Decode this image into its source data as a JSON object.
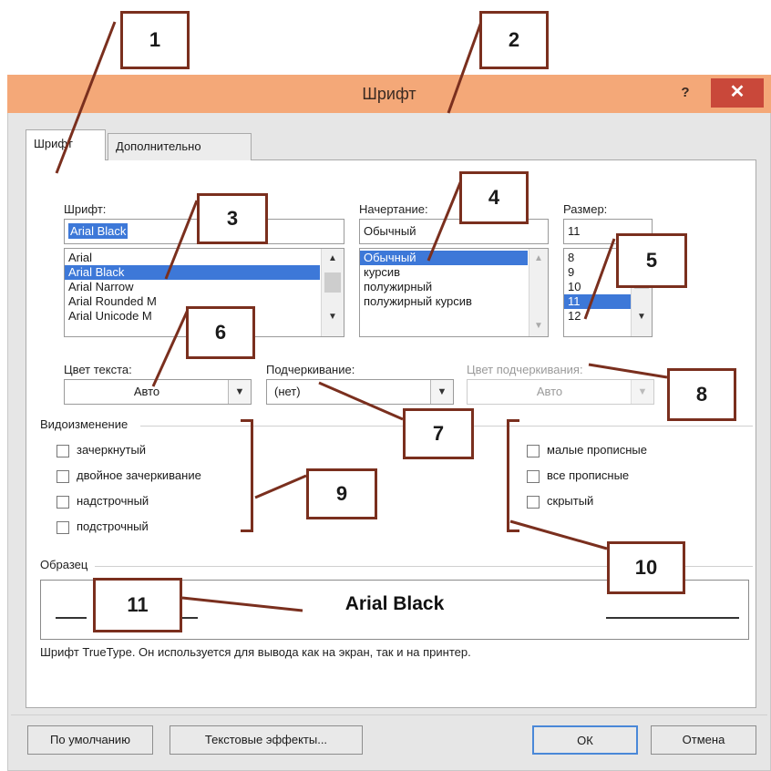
{
  "dialog": {
    "title": "Шрифт",
    "help": "?",
    "close": "✕"
  },
  "tabs": [
    {
      "label": "Шрифт",
      "active": true
    },
    {
      "label": "Дополнительно",
      "active": false
    }
  ],
  "font": {
    "label": "Шрифт:",
    "value": "Arial Black",
    "items": [
      "Arial",
      "Arial Black",
      "Arial Narrow",
      "Arial Rounded M",
      "Arial Unicode M"
    ],
    "selected_index": 1
  },
  "style": {
    "label": "Начертание:",
    "value": "Обычный",
    "items": [
      "Обычный",
      "курсив",
      "полужирный",
      "полужирный курсив"
    ],
    "selected_index": 0
  },
  "size": {
    "label": "Размер:",
    "value": "11",
    "items": [
      "8",
      "9",
      "10",
      "11",
      "12"
    ],
    "selected_index": 3
  },
  "text_color": {
    "label": "Цвет текста:",
    "value": "Авто"
  },
  "underline": {
    "label": "Подчеркивание:",
    "value": "(нет)"
  },
  "underline_color": {
    "label": "Цвет подчеркивания:",
    "value": "Авто",
    "disabled": true
  },
  "effects": {
    "group_label": "Видоизменение",
    "left": [
      {
        "label": "зачеркнутый",
        "checked": false
      },
      {
        "label": "двойное зачеркивание",
        "checked": false
      },
      {
        "label": "надстрочный",
        "checked": false
      },
      {
        "label": "подстрочный",
        "checked": false
      }
    ],
    "right": [
      {
        "label": "малые прописные",
        "checked": false
      },
      {
        "label": "все прописные",
        "checked": false
      },
      {
        "label": "скрытый",
        "checked": false
      }
    ]
  },
  "preview": {
    "group_label": "Образец",
    "sample": "Arial Black",
    "note": "Шрифт TrueType. Он используется для вывода как на экран, так и на принтер."
  },
  "buttons": {
    "default": "По умолчанию",
    "text_effects": "Текстовые эффекты...",
    "ok": "ОК",
    "cancel": "Отмена"
  },
  "callouts": [
    "1",
    "2",
    "3",
    "4",
    "5",
    "6",
    "7",
    "8",
    "9",
    "10",
    "11"
  ],
  "colors": {
    "titlebar": "#f4a878",
    "close_button": "#c9483a",
    "selection": "#3d78d8",
    "callout_border": "#7a2f1e"
  }
}
